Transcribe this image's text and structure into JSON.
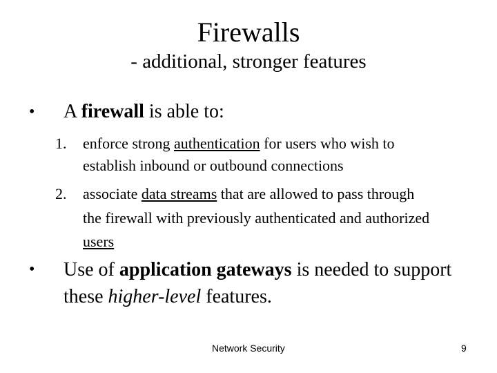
{
  "slide": {
    "title": "Firewalls",
    "subtitle": "- additional, stronger features",
    "bullet_symbol": "•",
    "bullets": [
      {
        "lines": [
          {
            "parts": [
              "A ",
              "firewall",
              " is able to:"
            ]
          }
        ],
        "subitems": [
          {
            "number": "1.",
            "lines": [
              {
                "parts": [
                  "enforce strong ",
                  "authentication",
                  " for users who wish to"
                ]
              },
              {
                "parts": [
                  "establish inbound or outbound connections"
                ]
              }
            ]
          },
          {
            "number": "2.",
            "lines": [
              {
                "parts": [
                  "associate ",
                  "data streams",
                  " that are allowed to pass through"
                ]
              },
              {
                "parts": [
                  "the firewall with previously authenticated and authorized"
                ]
              },
              {
                "parts": [
                  "users"
                ]
              }
            ]
          }
        ]
      },
      {
        "lines": [
          {
            "parts": [
              "Use of ",
              "application gateways",
              " is needed to support"
            ]
          },
          {
            "parts": [
              "these ",
              "higher-level",
              " features."
            ]
          }
        ]
      }
    ]
  },
  "footer": {
    "center_text": "Network Security",
    "page_number": "9"
  }
}
